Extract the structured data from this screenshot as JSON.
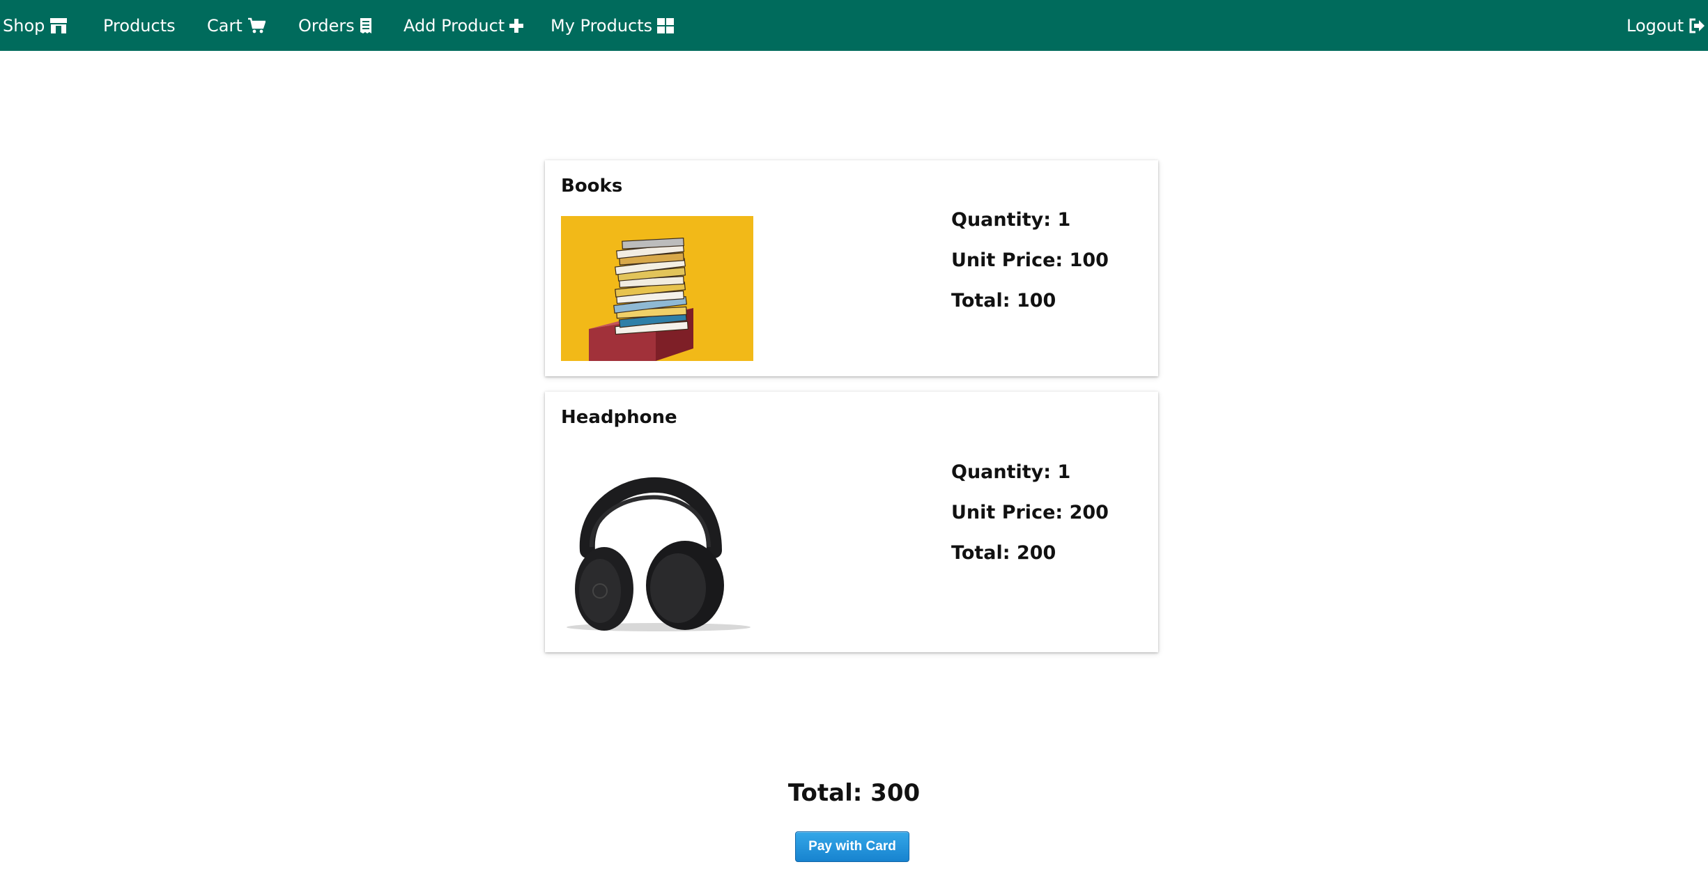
{
  "nav": {
    "shop": "Shop",
    "products": "Products",
    "cart": "Cart",
    "orders": "Orders",
    "add_product": "Add Product",
    "my_products": "My Products",
    "logout": "Logout"
  },
  "icons": {
    "shop": "store-icon",
    "cart": "shopping-cart-icon",
    "orders": "receipt-icon",
    "add_product": "plus-icon",
    "my_products": "grid-icon",
    "logout": "sign-out-icon"
  },
  "colors": {
    "navbar": "#006b5c",
    "pay_button": "#1f8fdb",
    "books_background": "#f2b918"
  },
  "cart_items": [
    {
      "title": "Books",
      "quantity": "Quantity: 1",
      "unit_price": "Unit Price: 100",
      "total": "Total: 100"
    },
    {
      "title": "Headphone",
      "quantity": "Quantity: 1",
      "unit_price": "Unit Price: 200",
      "total": "Total: 200"
    }
  ],
  "summary": {
    "total": "Total: 300",
    "pay_label": "Pay with Card"
  }
}
